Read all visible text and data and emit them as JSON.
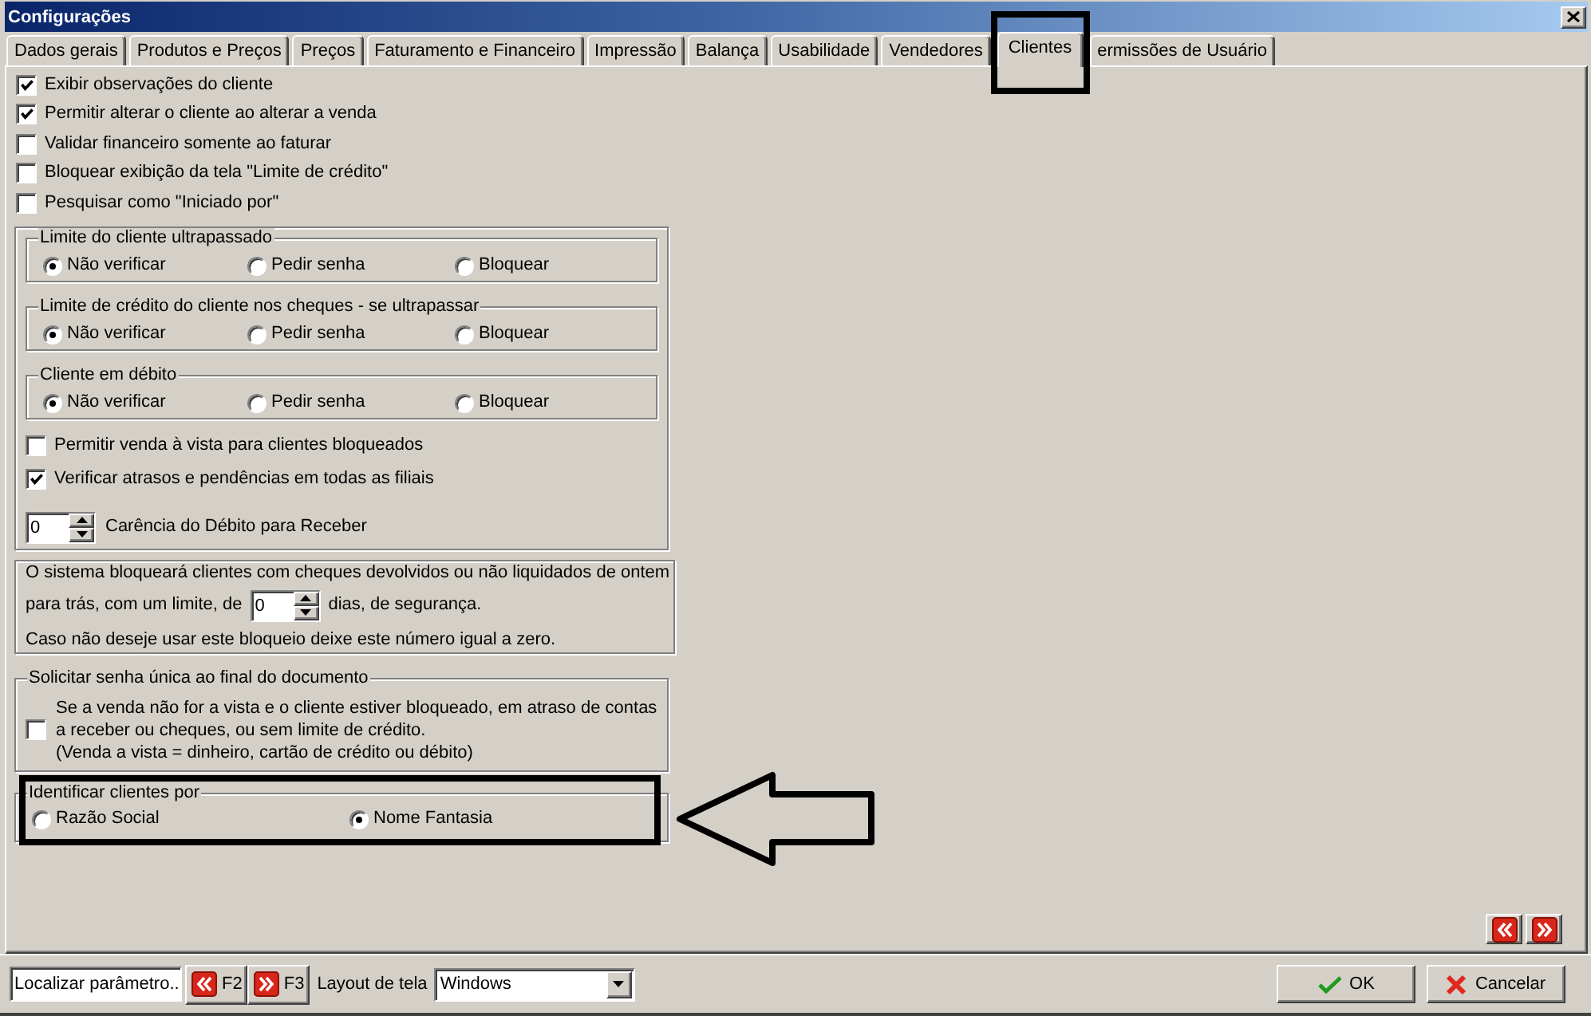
{
  "window": {
    "title": "Configurações"
  },
  "tabs": [
    {
      "label": "Dados gerais",
      "selected": false,
      "highlighted": false
    },
    {
      "label": "Produtos e Preços",
      "selected": false,
      "highlighted": false
    },
    {
      "label": "Preços",
      "selected": false,
      "highlighted": false
    },
    {
      "label": "Faturamento e Financeiro",
      "selected": false,
      "highlighted": false
    },
    {
      "label": "Impressão",
      "selected": false,
      "highlighted": false
    },
    {
      "label": "Balança",
      "selected": false,
      "highlighted": false
    },
    {
      "label": "Usabilidade",
      "selected": false,
      "highlighted": false
    },
    {
      "label": "Vendedores",
      "selected": false,
      "highlighted": false
    },
    {
      "label": "Clientes",
      "selected": true,
      "highlighted": true
    },
    {
      "label": "ermissões de Usuário",
      "selected": false,
      "highlighted": false
    }
  ],
  "options": [
    {
      "label": "Exibir observações do cliente",
      "checked": true
    },
    {
      "label": "Permitir alterar o cliente ao alterar a venda",
      "checked": true
    },
    {
      "label": "Validar financeiro somente ao faturar",
      "checked": false
    },
    {
      "label": "Bloquear exibição da tela \"Limite de crédito\"",
      "checked": false
    },
    {
      "label": "Pesquisar como \"Iniciado por\"",
      "checked": false
    }
  ],
  "limit_groups": [
    {
      "title": "Limite do cliente ultrapassado",
      "options": [
        {
          "label": "Não verificar",
          "selected": true
        },
        {
          "label": "Pedir senha",
          "selected": false
        },
        {
          "label": "Bloquear",
          "selected": false
        }
      ]
    },
    {
      "title": "Limite de crédito do cliente nos cheques - se ultrapassar",
      "options": [
        {
          "label": "Não verificar",
          "selected": true
        },
        {
          "label": "Pedir senha",
          "selected": false
        },
        {
          "label": "Bloquear",
          "selected": false
        }
      ]
    },
    {
      "title": "Cliente em débito",
      "options": [
        {
          "label": "Não verificar",
          "selected": true
        },
        {
          "label": "Pedir senha",
          "selected": false
        },
        {
          "label": "Bloquear",
          "selected": false
        }
      ]
    }
  ],
  "blocked_options": [
    {
      "label": "Permitir venda à vista para clientes bloqueados",
      "checked": false
    },
    {
      "label": "Verificar atrasos e pendências em todas as filiais",
      "checked": true
    }
  ],
  "grace_period": {
    "value": "0",
    "label": "Carência do Débito para Receber"
  },
  "returned_checks": {
    "intro": "O sistema bloqueará clientes com cheques devolvidos ou não liquidados de ontem",
    "before_field": "para trás, com um limite, de",
    "value": "0",
    "after_field": "dias, de segurança.",
    "note": "Caso não deseje usar este bloqueio deixe este número igual a zero."
  },
  "single_password": {
    "title": "Solicitar senha única ao final do documento",
    "checked": false,
    "description": [
      "Se a venda não for a vista e o cliente estiver bloqueado, em atraso de contas",
      "a receber ou cheques, ou sem limite de crédito.",
      "(Venda a vista = dinheiro, cartão de crédito ou débito)"
    ]
  },
  "identify_by": {
    "title": "Identificar clientes por",
    "highlighted": true,
    "pointed_at": true,
    "options": [
      {
        "label": "Razão Social",
        "selected": false
      },
      {
        "label": "Nome Fantasia",
        "selected": true
      }
    ]
  },
  "footer": {
    "search": {
      "value": "Localizar parâmetro.."
    },
    "previous_key": "F2",
    "next_key": "F3",
    "layout_label": "Layout de tela",
    "layout": {
      "value": "Windows"
    },
    "buttons": [
      {
        "label": "OK",
        "kind": "confirm"
      },
      {
        "label": "Cancelar",
        "kind": "cancel"
      }
    ]
  }
}
